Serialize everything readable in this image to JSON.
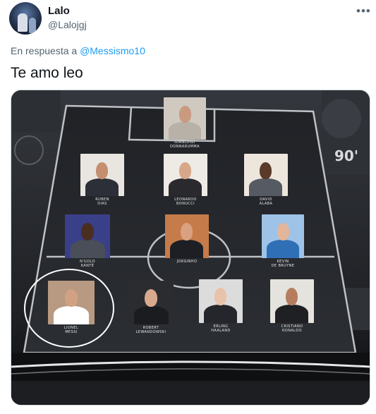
{
  "tweet": {
    "author_name": "Lalo",
    "author_handle": "@Lalojgj",
    "reply_prefix": "En respuesta a",
    "reply_to": "@Messismo10",
    "text": "Te amo leo",
    "more_icon": "more-icon"
  },
  "lineup": {
    "badge_text": "90'",
    "players": [
      {
        "id": "gk",
        "label": "GIANLUIGI\nDONNARUMMA",
        "bg": "#cfc9c0",
        "skin": "#c99a7e",
        "shirt": "#b7b1a8"
      },
      {
        "id": "rd",
        "label": "RÚBEN\nDIAS",
        "bg": "#e9e6e1",
        "skin": "#c58f6f",
        "shirt": "#2c2f38"
      },
      {
        "id": "lb",
        "label": "LEONARDO\nBONUCCI",
        "bg": "#eeeae5",
        "skin": "#d7a78a",
        "shirt": "#2a2a2e"
      },
      {
        "id": "da",
        "label": "DAVID\nALABA",
        "bg": "#ece6dc",
        "skin": "#5a3a28",
        "shirt": "#555a63"
      },
      {
        "id": "nk",
        "label": "N'GOLO\nKANTÉ",
        "bg": "#3a3f8a",
        "skin": "#4a2e20",
        "shirt": "#4a4e58"
      },
      {
        "id": "jo",
        "label": "JORGINHO",
        "bg": "#c67b4a",
        "skin": "#d9a182",
        "shirt": "#1e1f24"
      },
      {
        "id": "kd",
        "label": "KEVIN\nDE BRUYNE",
        "bg": "#9ec3e6",
        "skin": "#e3b59a",
        "shirt": "#2f6fb6"
      },
      {
        "id": "lm",
        "label": "LIONEL\nMESSI",
        "bg": "#b89a82",
        "skin": "#d2a184",
        "shirt": "#ffffff"
      },
      {
        "id": "rl",
        "label": "ROBERT\nLEWANDOWSKI",
        "bg": "#2a2c30",
        "skin": "#d9a98e",
        "shirt": "#1b1c20"
      },
      {
        "id": "eh",
        "label": "ERLING\nHAALAND",
        "bg": "#dcdcdc",
        "skin": "#e8c3aa",
        "shirt": "#24262b"
      },
      {
        "id": "cr",
        "label": "CRISTIANO\nRONALDO",
        "bg": "#e5e3dd",
        "skin": "#b57d5e",
        "shirt": "#1f2024"
      }
    ]
  }
}
